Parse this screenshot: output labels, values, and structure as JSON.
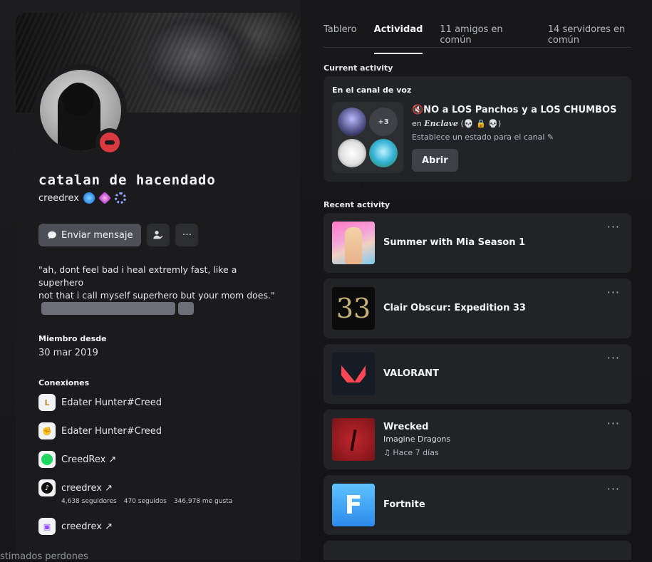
{
  "profile": {
    "display_name": "catalan de hacendado",
    "username": "creedrex",
    "send_message": "Enviar mensaje",
    "more": "···",
    "bio_line1": "\"ah, dont feel bad i heal extremly fast, like a superhero",
    "bio_line2": "not that i call myself superhero but your mom does.\"",
    "member_since_label": "Miembro desde",
    "member_since": "30 mar 2019",
    "connections_label": "Conexiones",
    "connections": [
      {
        "name": "Edater Hunter#Creed"
      },
      {
        "name": "Edater Hunter#Creed"
      },
      {
        "name": "CreedRex ↗"
      },
      {
        "name": "creedrex ↗"
      },
      {
        "name": "creedrex ↗"
      }
    ],
    "tiktok_stats": {
      "followers": "4,638 seguidores",
      "following": "470 seguidos",
      "likes": "346,978 me gusta"
    }
  },
  "tabs": {
    "t1": "Tablero",
    "t2": "Actividad",
    "t3": "11 amigos en común",
    "t4": "14 servidores en común"
  },
  "current_activity": {
    "label": "Current activity",
    "voice_title": "En el canal de voz",
    "extra_count": "+3",
    "channel": "🔇NO a LOS Panchos y a LOS CHUMBOS",
    "server_prefix": "en",
    "server_name": "Enclave",
    "server_emojis": "(💀 🔒 💀)",
    "status": "Establece un estado para el canal ✎",
    "open_button": "Abrir"
  },
  "recent_activity": {
    "label": "Recent activity",
    "more": "···",
    "items": [
      {
        "name": "Summer with Mia Season 1"
      },
      {
        "name": "Clair Obscur: Expedition 33",
        "thumb_text": "33"
      },
      {
        "name": "VALORANT"
      },
      {
        "name": "Wrecked",
        "artist": "Imagine Dragons",
        "time": "♫ Hace 7 días"
      },
      {
        "name": "Fortnite",
        "thumb_text": "F"
      }
    ]
  },
  "bottom": {
    "text": "stimados perdones"
  }
}
